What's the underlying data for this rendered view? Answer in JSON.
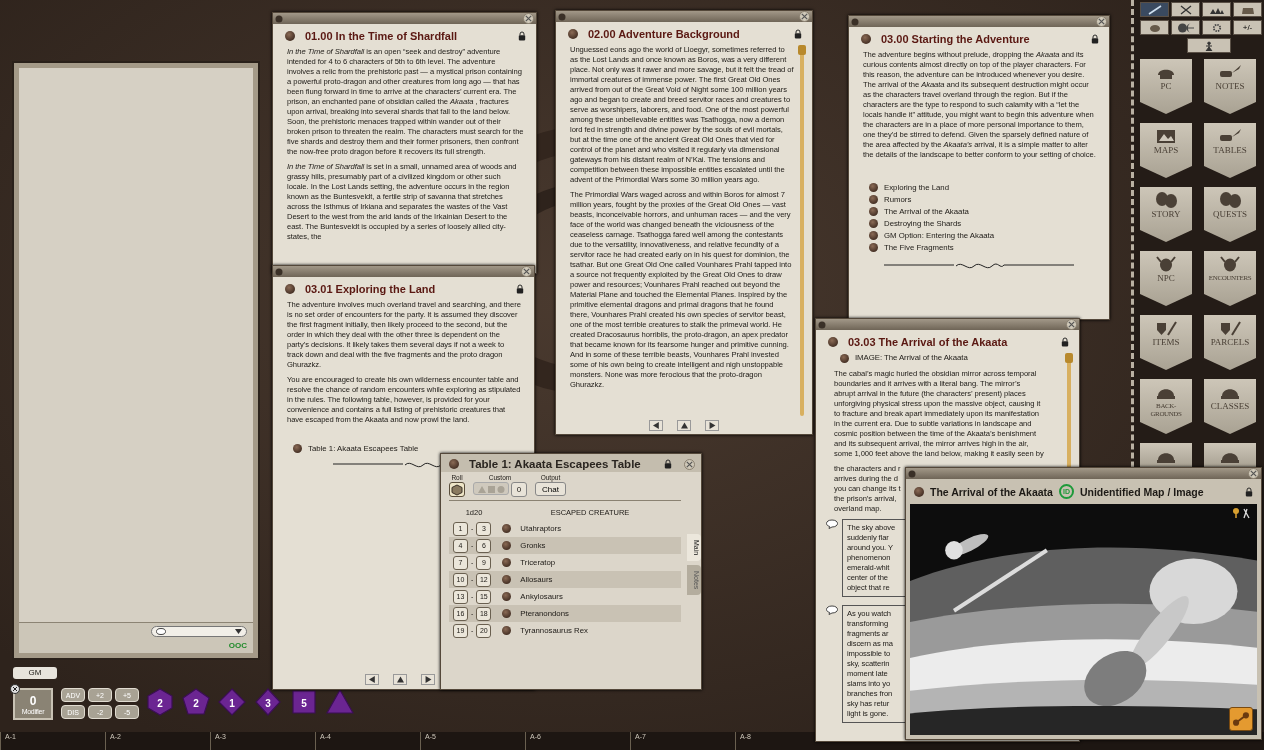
{
  "chat": {
    "mode": "OOC"
  },
  "identity": {
    "label": "GM"
  },
  "modifier": {
    "value": "0",
    "label": "Modifier"
  },
  "modifier_buttons": [
    {
      "label": "ADV"
    },
    {
      "label": "+2"
    },
    {
      "label": "+5"
    },
    {
      "label": "DIS"
    },
    {
      "label": "-2"
    },
    {
      "label": "-5"
    }
  ],
  "dice": [
    {
      "kind": "d20",
      "count": "2"
    },
    {
      "kind": "d12",
      "count": "2"
    },
    {
      "kind": "d10",
      "count": "1"
    },
    {
      "kind": "d8",
      "count": "3"
    },
    {
      "kind": "d6",
      "count": "5"
    },
    {
      "kind": "d4"
    }
  ],
  "shardfall": {
    "title": "01.00 In the Time of Shardfall",
    "paragraphs": [
      "*In the Time of Shardfall* is an open “seek and destroy” adventure intended for 4 to 6 characters of 5th to 6th level. The adventure involves a relic from the prehistoric past — a mystical prison containing a powerful proto-dragon and other creatures from long ago — that has been flung forward in time to arrive at the characters’ current era. The prison, an enchanted pane of obsidian called the *Akaata* , fractures upon arrival, breaking into several shards that fall to the land below. Soon, the prehistoric menaces trapped within wander out of their broken prison to threaten the realm. The characters must search for the five shards and destroy them and their former prisoners, then confront the now-free proto dragon before it recovers its full strength.",
      "*In the Time of Shardfall* is set in a small, unnamed area of woods and grassy hills, presumably part of a civilized kingdom or other such locale. In the Lost Lands setting, the adventure occurs in the region known as the Buntesveldt, a fertile strip of savanna that stretches across the Isthmus of Irkiana and separates the wastes of the Vast Desert to the west from the arid lands of the Irkainian Desert to the east. The Buntesveldt is occupied by a series of loosely allied city-states, the"
    ]
  },
  "background": {
    "title": "02.00 Adventure Background",
    "paragraphs": [
      "Unguessed eons ago the world of Lloegyr, sometimes referred to as the Lost Lands and once known as Boros, was a very different place. Not only was it rawer and more savage, but it felt the tread of immortal creatures of immense power. The first Great Old Ones arrived from out of the Great Void of Night some 100 million years ago and began to create and breed servitor races and creatures to serve as worshipers, laborers, and food. One of the most powerful among these unbelievable entities was Tsathogga, now a demon lord fed in strength and divine power by the souls of evil mortals, but at the time one of the ancient Great Old Ones that vied for control of the planet and who visited it regularly via dimensional gateways from his distant realm of N’Kai. The tensions and competition between these impossible entities escalated until the advent of the Primordial Wars some 30 million years ago.",
      "The Primordial Wars waged across and within Boros for almost 7 million years, fought by the proxies of the Great Old Ones — vast beasts, inconceivable horrors, and unhuman races — and the very face of the world was changed beneath the viciousness of the ceaseless carnage. Tsathogga fared well among the contestants due to the versatility, innovativeness, and relative fecundity of a servitor race he had created early on in his quest for dominion, the tsathar. But one Great Old One called Vounhares Prahl tapped into a source not frequently exploited by the Great Old Ones to draw power and resources; Vounhares Prahl reached out beyond the Material Plane and touched the Elemental Planes. Inspired by the primitive elemental dragons and primal dragons that he found there, Vounhares Prahl created his own species of servitor beast, one of the most terrible creatures to stalk the primeval world. He created Dracosaurus horriblis, the proto-dragon, an apex predator that became known for its fearsome hunger and primitive cunning. And in some of these terrible beasts, Vounhares Prahl invested some of his own being to create intelligent and nigh unstoppable monsters. None was more ferocious that the proto-dragon Ghurazkz."
    ]
  },
  "starting": {
    "title": "03.00 Starting the Adventure",
    "paragraphs": [
      "The adventure begins without prelude, dropping the *Akaata* and its curious contents almost directly on top of the player characters. For this reason, the adventure can be introduced whenever you desire. The arrival of the *Akaata* and its subsequent destruction might occur as the characters travel overland through the region. But if the characters are the type to respond to such calamity with a “let the locals handle it” attitude, you might want to begin this adventure when the characters are in a place of more personal importance to them, one they’d be stirred to defend. Given the sparsely defined nature of the area affected by the *Akaata’s* arrival, it is a simple matter to alter the details of the landscape to better conform to your setting of choice."
    ],
    "links": [
      "Exploring the Land",
      "Rumors",
      "The Arrival of the Akaata",
      "Destroying the Shards",
      "GM Option: Entering the Akaata",
      "The Five Fragments"
    ]
  },
  "exploring": {
    "title": "03.01 Exploring the Land",
    "paragraphs": [
      "The adventure involves much overland travel and searching, and there is no set order of encounters for the party. It is assumed they discover the first fragment initially, then likely proceed to the second, but the order in which they deal with the other three is dependent on the party’s decisions. It likely takes them several days if not a week to track down and deal with the five fragments and the proto dragon Ghurazkz.",
      "You are encouraged to create his own wilderness encounter table and resolve the chance of random encounters while exploring as stipulated in the rules. The following table, however, is provided for your convenience and contains a full listing of prehistoric creatures that have escaped from the Akaata and now prowl the land."
    ],
    "links": [
      "Table 1: Akaata Escapees Table"
    ]
  },
  "arrival": {
    "title": "03.03 The Arrival of the Akaata",
    "links": [
      "IMAGE: The Arrival of the Akaata"
    ],
    "paragraph_lines": [
      "The cabal’s magic hurled the obsidian mirror across temporal",
      "boundaries and it arrives with a literal bang. The mirror’s",
      "abrupt arrival in the future (the characters’ present) places",
      "unforgiving physical stress upon the massive object, causing it",
      "to fracture and break apart immediately upon its manifestation",
      "in the current era. Due to subtle variations in landscape and",
      "cosmic position between the time of the Akaata’s benishment",
      "and its subsequent arrival, the mirror arrives high in the air,",
      "some 1,000 feet above the land below, making it easily seen by"
    ],
    "cut_lines": [
      "the characters and r",
      "arrives during the d",
      "you can change its t",
      "the prison’s arrival,",
      "overland map."
    ],
    "quotes": [
      {
        "lines": [
          "The sky above",
          "suddenly flar",
          "around you. Y",
          "phenomenon",
          "emerald-whit",
          "center of the",
          "object that re"
        ]
      },
      {
        "lines": [
          "As you watch",
          "transforming",
          "fragments ar",
          "discern as ma",
          "impossible to",
          "sky, scatterin",
          "moment late",
          "slams into yo",
          "branches fron",
          "sky has retur",
          "light is gone."
        ]
      }
    ]
  },
  "table": {
    "title": "Table 1: Akaata Escapees Table",
    "roll_label": "Roll",
    "custom_label": "Custom",
    "custom_count": "0",
    "output_label": "Output",
    "output": "Chat",
    "dice_column": "1d20",
    "result_column": "ESCAPED CREATURE",
    "range_separator": "-",
    "rows": [
      {
        "from": "1",
        "to": "3",
        "result": "Utahraptors"
      },
      {
        "from": "4",
        "to": "6",
        "result": "Gronks"
      },
      {
        "from": "7",
        "to": "9",
        "result": "Triceratop"
      },
      {
        "from": "10",
        "to": "12",
        "result": "Allosaurs"
      },
      {
        "from": "13",
        "to": "15",
        "result": "Ankylosaurs"
      },
      {
        "from": "16",
        "to": "18",
        "result": "Pteranondons"
      },
      {
        "from": "19",
        "to": "20",
        "result": "Tyrannosaurus Rex"
      }
    ],
    "tabs": [
      {
        "label": "Main",
        "selected": true
      },
      {
        "label": "Notes",
        "selected": false
      }
    ]
  },
  "image_window": {
    "title": "The Arrival of the Akaata",
    "id_badge": "ID",
    "subtitle": "Unidentified Map / Image",
    "kind": "picture"
  },
  "toolbar": [
    {
      "kind": "wand",
      "selected": true
    },
    {
      "kind": "swords",
      "selected": false
    },
    {
      "kind": "party",
      "selected": false
    },
    {
      "kind": "bag",
      "selected": false
    },
    {
      "kind": "pouch",
      "selected": false
    },
    {
      "kind": "sunmoon",
      "selected": false
    },
    {
      "kind": "gear",
      "selected": false
    },
    {
      "kind": "text",
      "label": "+/-",
      "selected": false
    },
    {
      "kind": "person",
      "selected": false
    }
  ],
  "library": [
    {
      "label": "PC",
      "kind": "helmet"
    },
    {
      "label": "NOTES",
      "kind": "scroll"
    },
    {
      "label": "MAPS",
      "kind": "map"
    },
    {
      "label": "TABLES",
      "kind": "scroll"
    },
    {
      "label": "STORY",
      "kind": "masks"
    },
    {
      "label": "QUESTS",
      "kind": "masks"
    },
    {
      "label": "NPC",
      "kind": "skull"
    },
    {
      "label": "ENCOUNTERS",
      "kind": "skull"
    },
    {
      "label": "ITEMS",
      "kind": "shield"
    },
    {
      "label": "PARCELS",
      "kind": "shield"
    },
    {
      "label": "BACK-GROUNDS",
      "kind": "cap"
    },
    {
      "label": "CLASSES",
      "kind": "cap"
    },
    {
      "kind": "cap"
    },
    {
      "kind": "cap"
    }
  ],
  "grid_labels": [
    "A-1",
    "A-2",
    "A-3",
    "A-4",
    "A-5",
    "A-6",
    "A-7",
    "A-8"
  ]
}
